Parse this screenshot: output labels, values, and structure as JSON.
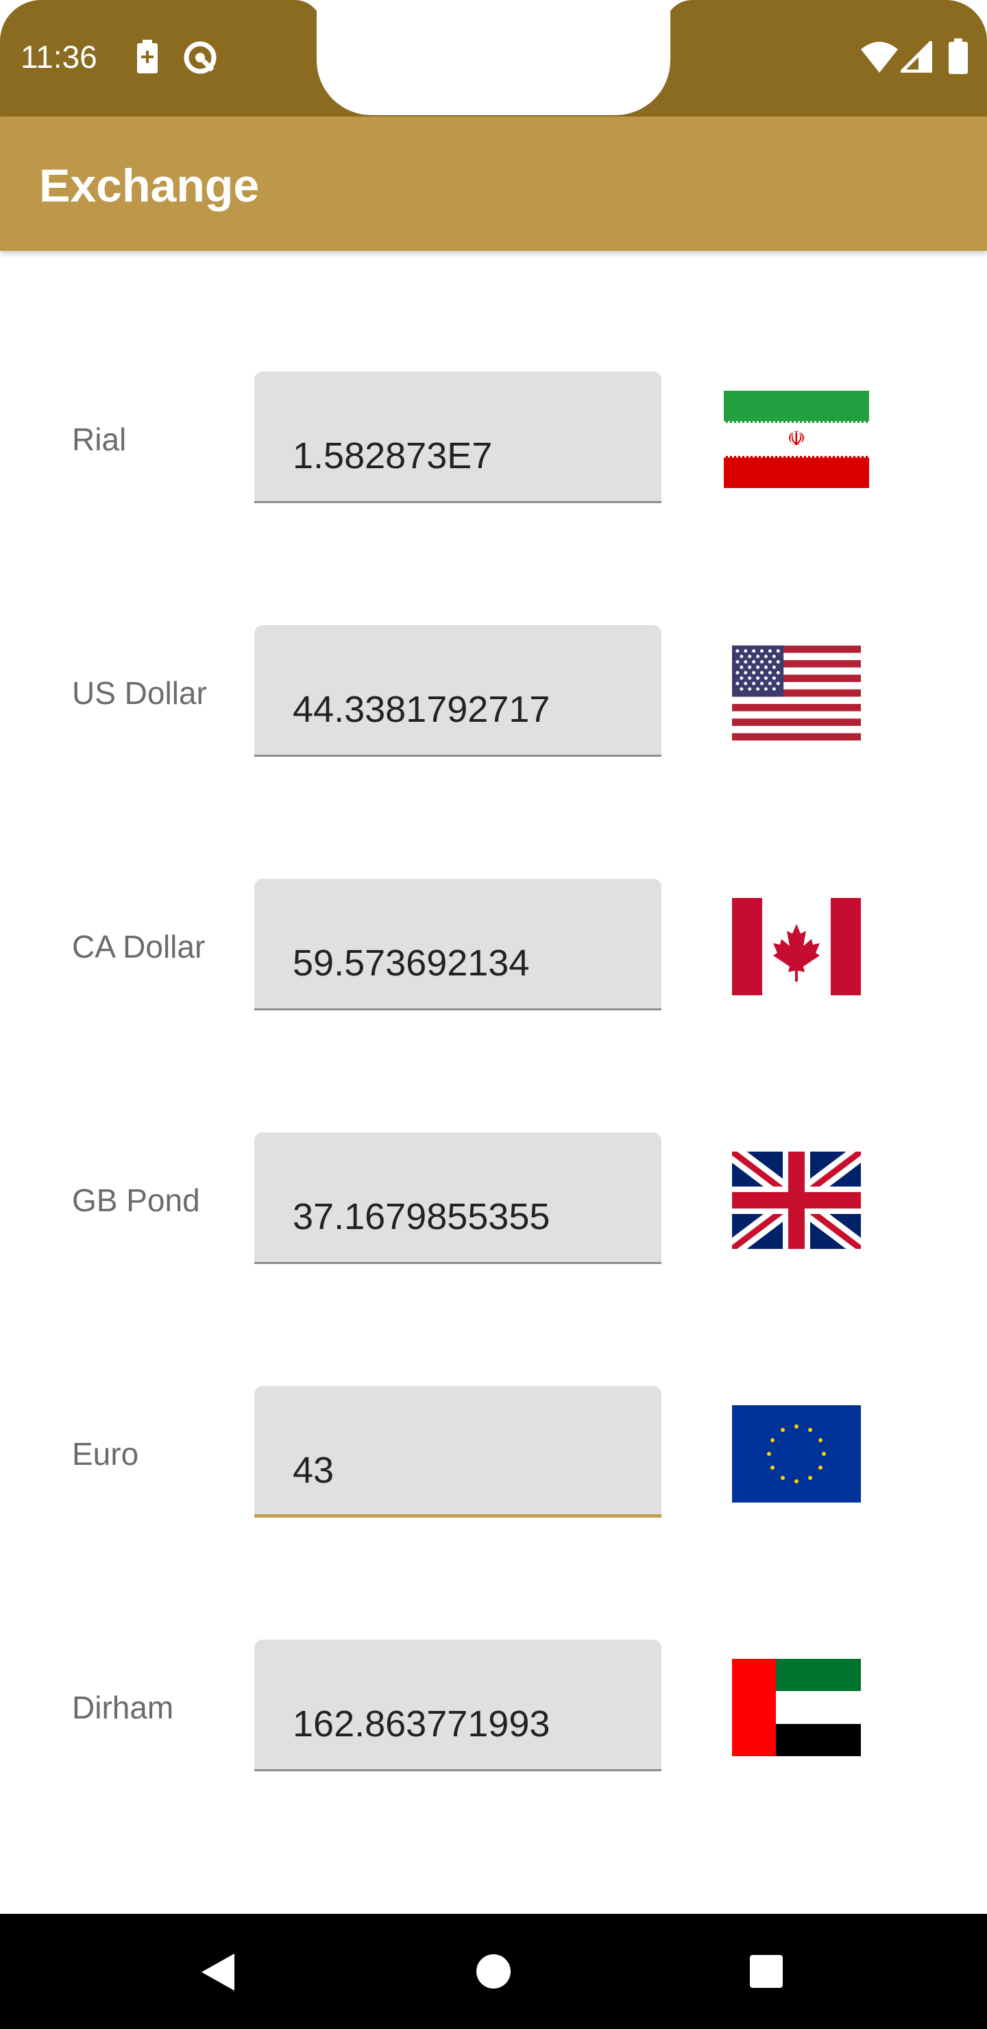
{
  "status_bar": {
    "time": "11:36",
    "icons": [
      "battery-saver-icon",
      "data-saver-icon",
      "wifi-icon",
      "signal-icon",
      "battery-icon"
    ]
  },
  "app_bar": {
    "title": "Exchange"
  },
  "currencies": [
    {
      "label": "Rial",
      "value": "1.582873E7",
      "flag": "iran-flag-icon",
      "focused": false
    },
    {
      "label": "US Dollar",
      "value": "44.3381792717",
      "flag": "usa-flag-icon",
      "focused": false
    },
    {
      "label": "CA Dollar",
      "value": "59.573692134",
      "flag": "canada-flag-icon",
      "focused": false
    },
    {
      "label": "GB Pond",
      "value": "37.1679855355",
      "flag": "uk-flag-icon",
      "focused": false
    },
    {
      "label": "Euro",
      "value": "43",
      "flag": "eu-flag-icon",
      "focused": true
    },
    {
      "label": "Dirham",
      "value": "162.863771993",
      "flag": "uae-flag-icon",
      "focused": false
    }
  ],
  "nav_bar": {
    "buttons": [
      "back-icon",
      "home-icon",
      "recents-icon"
    ]
  },
  "colors": {
    "status_bar": "#8b6b20",
    "app_bar": "#bd984b",
    "accent": "#c49b50",
    "field_bg": "#e0e0e0"
  }
}
